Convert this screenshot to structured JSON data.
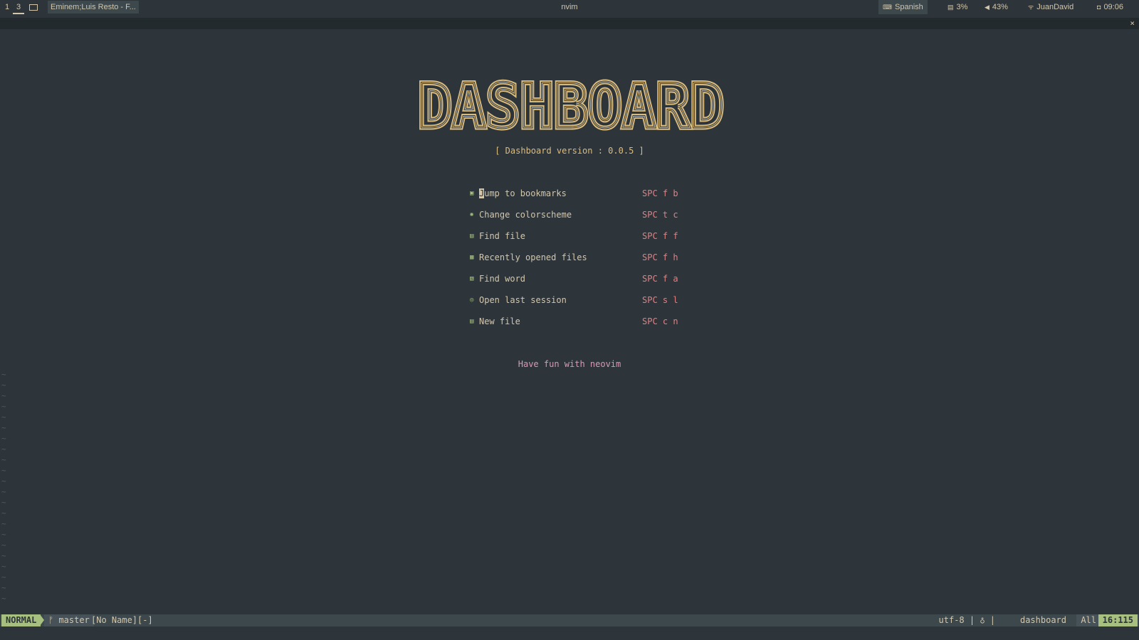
{
  "topbar": {
    "workspaces": [
      "1",
      "3"
    ],
    "window_title": "Eminem;Luis Resto - F...",
    "center_title": "nvim",
    "keyboard_layout": "Spanish",
    "disk_usage": "3%",
    "volume": "43%",
    "network": "JuanDavid",
    "clock": "09:06"
  },
  "tabline": {
    "close_label": "×"
  },
  "banner": {
    "text": "DASHBOARD",
    "color": "#dbbc7f"
  },
  "version_line": "[ Dashboard version : 0.0.5 ]",
  "menu": [
    {
      "icon": "bookmark-icon",
      "glyph": "▣",
      "first_char": "J",
      "rest": "ump to bookmarks",
      "shortcut": "SPC f b"
    },
    {
      "icon": "palette-icon",
      "glyph": "✺",
      "first_char": "",
      "rest": "Change colorscheme",
      "shortcut": "SPC t c"
    },
    {
      "icon": "file-icon",
      "glyph": "▤",
      "first_char": "",
      "rest": "Find file",
      "shortcut": "SPC f f"
    },
    {
      "icon": "history-icon",
      "glyph": "▦",
      "first_char": "",
      "rest": "Recently opened files",
      "shortcut": "SPC f h"
    },
    {
      "icon": "search-doc-icon",
      "glyph": "▧",
      "first_char": "",
      "rest": "Find word",
      "shortcut": "SPC f a"
    },
    {
      "icon": "session-icon",
      "glyph": "◎",
      "first_char": "",
      "rest": "Open last session",
      "shortcut": "SPC s l"
    },
    {
      "icon": "new-file-icon",
      "glyph": "▤",
      "first_char": "",
      "rest": "New file",
      "shortcut": "SPC c n"
    }
  ],
  "footer": "Have fun with neovim",
  "tilde": "~",
  "statusline": {
    "mode": "NORMAL",
    "branch": "ᚠ master",
    "file": "[No Name][-]",
    "encoding": "utf-8 | ♁ |",
    "filetype": "dashboard",
    "scroll": "All",
    "position": "16:115"
  },
  "colors": {
    "background": "#2d353b",
    "foreground": "#d3c6aa",
    "accent_yellow": "#dbbc7f",
    "accent_green": "#a7c080",
    "accent_red": "#e67e80",
    "accent_pink": "#d699b6"
  }
}
